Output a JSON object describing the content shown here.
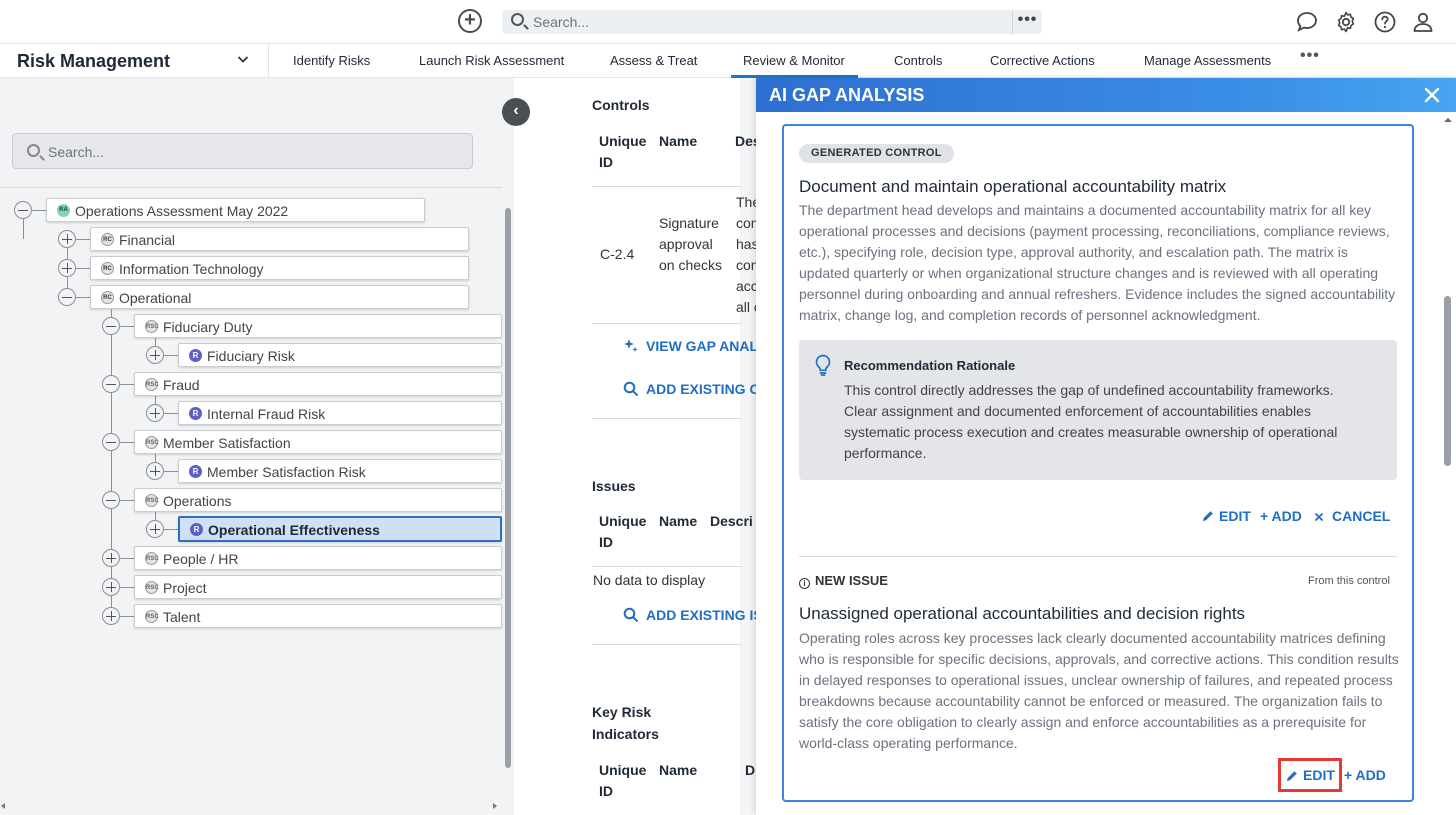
{
  "topbar": {
    "search_placeholder": "Search...",
    "more_label": "•••",
    "icons": [
      "add-circle-icon",
      "search-icon",
      "chat-icon",
      "gear-icon",
      "help-icon",
      "user-icon"
    ]
  },
  "nav": {
    "app_title": "Risk Management",
    "tabs": [
      "Identify Risks",
      "Launch Risk Assessment",
      "Assess & Treat",
      "Review & Monitor",
      "Controls",
      "Corrective Actions",
      "Manage Assessments"
    ],
    "active_tab": "Review & Monitor",
    "more_label": "•••",
    "accent_color": "#1f77c8"
  },
  "tree": {
    "search_placeholder": "Search...",
    "collapse_label": "‹",
    "root": {
      "badge": "RA",
      "label": "Operations Assessment May 2022"
    },
    "level1": [
      {
        "badge": "RC",
        "label": "Financial"
      },
      {
        "badge": "RC",
        "label": "Information Technology"
      },
      {
        "badge": "RC",
        "label": "Operational"
      }
    ],
    "operational_children": [
      {
        "badge": "RSC",
        "label": "Fiduciary Duty",
        "child": {
          "badge": "R",
          "label": "Fiduciary Risk"
        }
      },
      {
        "badge": "RSC",
        "label": "Fraud",
        "child": {
          "badge": "R",
          "label": "Internal Fraud Risk"
        }
      },
      {
        "badge": "RSC",
        "label": "Member Satisfaction",
        "child": {
          "badge": "R",
          "label": "Member Satisfaction Risk"
        }
      },
      {
        "badge": "RSC",
        "label": "Operations",
        "child": {
          "badge": "R",
          "label": "Operational Effectiveness"
        }
      },
      {
        "badge": "RSC",
        "label": "People / HR"
      },
      {
        "badge": "RSC",
        "label": "Project"
      },
      {
        "badge": "RSC",
        "label": "Talent"
      }
    ]
  },
  "middle": {
    "controls": {
      "title": "Controls",
      "headers": [
        "Unique ID",
        "Name",
        "Des"
      ],
      "row": {
        "id": "C-2.4",
        "name": "Signature approval on checks",
        "desc": "The con has con acc all c"
      },
      "actions": [
        "VIEW GAP ANAL",
        "ADD EXISTING C"
      ]
    },
    "issues": {
      "title": "Issues",
      "headers": [
        "Unique ID",
        "Name",
        "Descri"
      ],
      "empty": "No data to display",
      "action": "ADD EXISTING IS"
    },
    "kri": {
      "title": "Key Risk Indicators",
      "headers": [
        "Unique ID",
        "Name",
        "D"
      ]
    }
  },
  "gap_panel": {
    "title": "AI GAP ANALYSIS",
    "close_label": "×",
    "control": {
      "tag": "GENERATED CONTROL",
      "title": "Document and maintain operational accountability matrix",
      "description": "The department head develops and maintains a documented accountability matrix for all key operational processes and decisions (payment processing, reconciliations, compliance reviews, etc.), specifying role, decision type, approval authority, and escalation path. The matrix is updated quarterly or when organizational structure changes and is reviewed with all operating personnel during onboarding and annual refreshers. Evidence includes the signed accountability matrix, change log, and completion records of personnel acknowledgment.",
      "rationale_title": "Recommendation Rationale",
      "rationale_text": "This control directly addresses the gap of undefined accountability frameworks. Clear assignment and documented enforcement of accountabilities enables systematic process execution and creates measurable ownership of operational performance.",
      "actions": {
        "edit": "EDIT",
        "add": "+ ADD",
        "cancel": "CANCEL"
      }
    },
    "issue": {
      "tag": "NEW ISSUE",
      "source": "From this control",
      "title": "Unassigned operational accountabilities and decision rights",
      "description": "Operating roles across key processes lack clearly documented accountability matrices defining who is responsible for specific decisions, approvals, and corrective actions. This condition results in delayed responses to operational issues, unclear ownership of failures, and repeated process breakdowns because accountability cannot be enforced or measured. The organization fails to satisfy the core obligation to clearly assign and enforce accountabilities as a prerequisite for world-class operating performance.",
      "actions": {
        "edit": "EDIT",
        "add": "+ ADD"
      }
    },
    "colors": {
      "header_start": "#2e6fd1",
      "header_end": "#47a5f0",
      "link": "#1f6fc2",
      "highlight": "#e53935"
    }
  }
}
